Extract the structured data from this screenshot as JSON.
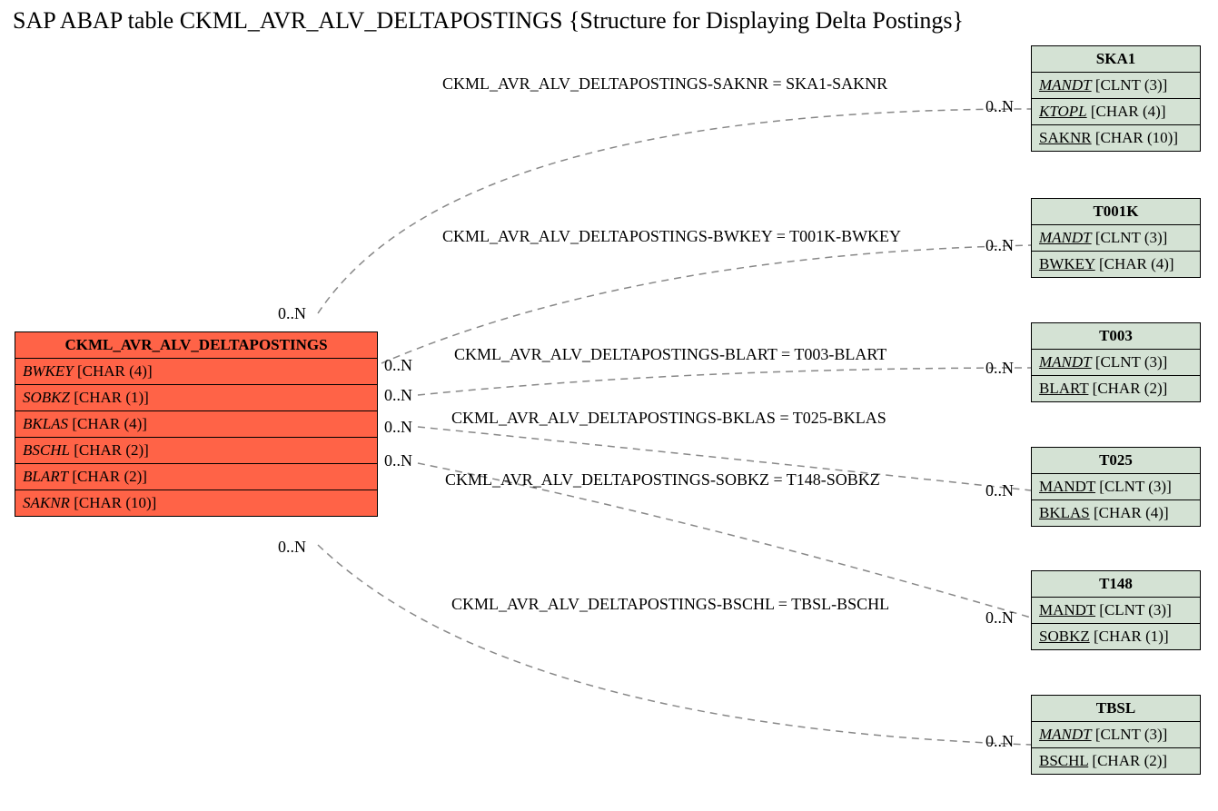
{
  "title": "SAP ABAP table CKML_AVR_ALV_DELTAPOSTINGS {Structure for Displaying Delta Postings}",
  "main": {
    "name": "CKML_AVR_ALV_DELTAPOSTINGS",
    "fields": [
      {
        "name": "BWKEY",
        "type": "[CHAR (4)]"
      },
      {
        "name": "SOBKZ",
        "type": "[CHAR (1)]"
      },
      {
        "name": "BKLAS",
        "type": "[CHAR (4)]"
      },
      {
        "name": "BSCHL",
        "type": "[CHAR (2)]"
      },
      {
        "name": "BLART",
        "type": "[CHAR (2)]"
      },
      {
        "name": "SAKNR",
        "type": "[CHAR (10)]"
      }
    ]
  },
  "rels": [
    {
      "name": "SKA1",
      "fields": [
        {
          "name": "MANDT",
          "type": "[CLNT (3)]",
          "italic": true
        },
        {
          "name": "KTOPL",
          "type": "[CHAR (4)]",
          "italic": true
        },
        {
          "name": "SAKNR",
          "type": "[CHAR (10)]",
          "italic": false
        }
      ],
      "label": "CKML_AVR_ALV_DELTAPOSTINGS-SAKNR = SKA1-SAKNR",
      "card_left": "0..N",
      "card_right": "0..N"
    },
    {
      "name": "T001K",
      "fields": [
        {
          "name": "MANDT",
          "type": "[CLNT (3)]",
          "italic": true
        },
        {
          "name": "BWKEY",
          "type": "[CHAR (4)]",
          "italic": false
        }
      ],
      "label": "CKML_AVR_ALV_DELTAPOSTINGS-BWKEY = T001K-BWKEY",
      "card_left": "0..N",
      "card_right": "0..N"
    },
    {
      "name": "T003",
      "fields": [
        {
          "name": "MANDT",
          "type": "[CLNT (3)]",
          "italic": true
        },
        {
          "name": "BLART",
          "type": "[CHAR (2)]",
          "italic": false
        }
      ],
      "label": "CKML_AVR_ALV_DELTAPOSTINGS-BLART = T003-BLART",
      "card_left": "0..N",
      "card_right": "0..N"
    },
    {
      "name": "T025",
      "fields": [
        {
          "name": "MANDT",
          "type": "[CLNT (3)]",
          "italic": false
        },
        {
          "name": "BKLAS",
          "type": "[CHAR (4)]",
          "italic": false
        }
      ],
      "label": "CKML_AVR_ALV_DELTAPOSTINGS-BKLAS = T025-BKLAS",
      "card_left": "0..N",
      "card_right": "0..N"
    },
    {
      "name": "T148",
      "fields": [
        {
          "name": "MANDT",
          "type": "[CLNT (3)]",
          "italic": false
        },
        {
          "name": "SOBKZ",
          "type": "[CHAR (1)]",
          "italic": false
        }
      ],
      "label": "CKML_AVR_ALV_DELTAPOSTINGS-SOBKZ = T148-SOBKZ",
      "card_left": "0..N",
      "card_right": "0..N"
    },
    {
      "name": "TBSL",
      "fields": [
        {
          "name": "MANDT",
          "type": "[CLNT (3)]",
          "italic": true
        },
        {
          "name": "BSCHL",
          "type": "[CHAR (2)]",
          "italic": false
        }
      ],
      "label": "CKML_AVR_ALV_DELTAPOSTINGS-BSCHL = TBSL-BSCHL",
      "card_left": "0..N",
      "card_right": "0..N"
    }
  ]
}
